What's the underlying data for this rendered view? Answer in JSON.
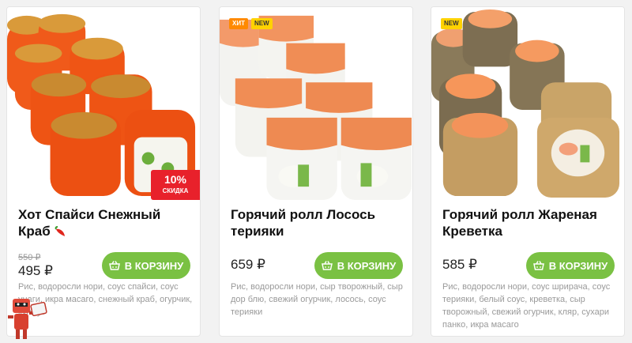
{
  "products": [
    {
      "title": "Хот Спайси Снежный Краб",
      "title_icon": "chili-pepper-icon",
      "old_price": "550 ₽",
      "price": "495 ₽",
      "discount_pct": "10%",
      "discount_label": "СКИДКА",
      "button_label": "В КОРЗИНУ",
      "description": "Рис, водоросли нори, соус спайси, соус унаги, икра масаго, снежный краб, огурчик, кунжут"
    },
    {
      "title": "Горячий ролл Лосось терияки",
      "badges": [
        "ХИТ",
        "NEW"
      ],
      "price": "659 ₽",
      "button_label": "В КОРЗИНУ",
      "description": "Рис, водоросли нори, сыр творожный, сыр дор блю, свежий огурчик, лосось, соус терияки"
    },
    {
      "title": "Горячий ролл Жареная Креветка",
      "badges": [
        "NEW"
      ],
      "price": "585 ₽",
      "button_label": "В КОРЗИНУ",
      "description": "Рис, водоросли нори, соус шрирача, соус терияки, белый соус, креветка, сыр творожный, свежий огурчик, кляр, сухари панко, икра масаго"
    }
  ],
  "colors": {
    "button_green": "#7ac143",
    "discount_red": "#e8212b",
    "hit_orange": "#ff8a00",
    "new_yellow": "#ffd200"
  }
}
